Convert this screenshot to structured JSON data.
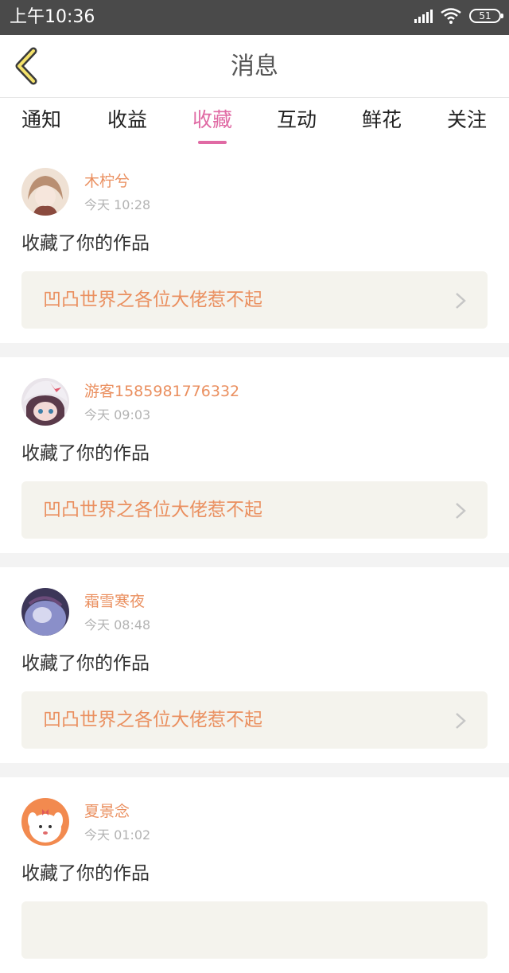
{
  "status_bar": {
    "time": "上午10:36",
    "battery": "51"
  },
  "header": {
    "title": "消息"
  },
  "tabs": [
    {
      "label": "通知",
      "active": false
    },
    {
      "label": "收益",
      "active": false
    },
    {
      "label": "收藏",
      "active": true
    },
    {
      "label": "互动",
      "active": false
    },
    {
      "label": "鲜花",
      "active": false
    },
    {
      "label": "关注",
      "active": false
    }
  ],
  "messages": [
    {
      "user": "木柠兮",
      "time": "今天 10:28",
      "text": "收藏了你的作品",
      "work": "凹凸世界之各位大佬惹不起",
      "avatar_color": "#c8a48a"
    },
    {
      "user": "游客1585981776332",
      "time": "今天 09:03",
      "text": "收藏了你的作品",
      "work": "凹凸世界之各位大佬惹不起",
      "avatar_color": "#6b4b5e"
    },
    {
      "user": "霜雪寒夜",
      "time": "今天 08:48",
      "text": "收藏了你的作品",
      "work": "凹凸世界之各位大佬惹不起",
      "avatar_color": "#7c7fb6"
    },
    {
      "user": "夏景念",
      "time": "今天 01:02",
      "text": "收藏了你的作品",
      "work": "",
      "avatar_color": "#f28a4f"
    }
  ],
  "colors": {
    "accent": "#e06aa4",
    "name": "#ea8f5f",
    "status_bar": "#4a4a4a"
  }
}
